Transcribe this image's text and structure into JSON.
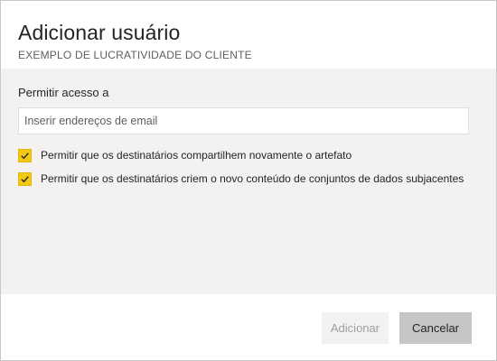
{
  "dialog": {
    "title": "Adicionar usuário",
    "subtitle": "EXEMPLO DE LUCRATIVIDADE DO CLIENTE"
  },
  "access": {
    "label": "Permitir acesso a",
    "email_placeholder": "Inserir endereços de email",
    "email_value": ""
  },
  "options": [
    {
      "label": "Permitir que os destinatários compartilhem novamente o artefato",
      "checked": true
    },
    {
      "label": "Permitir que os destinatários criem o novo conteúdo de conjuntos de dados subjacentes",
      "checked": true
    }
  ],
  "buttons": {
    "add_label": "Adicionar",
    "add_enabled": false,
    "cancel_label": "Cancelar"
  },
  "colors": {
    "checkbox_accent": "#f2c811",
    "body_background": "#f3f2f1",
    "cancel_background": "#c8c6c4"
  },
  "icons": {
    "checkbox_mark": "checkmark-icon"
  }
}
